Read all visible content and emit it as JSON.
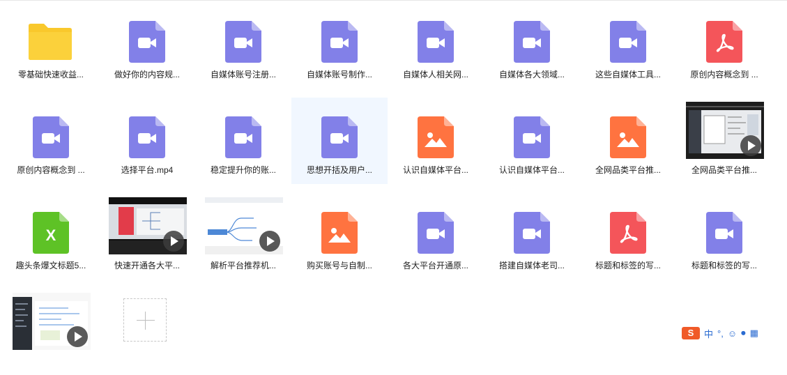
{
  "files": [
    {
      "type": "folder",
      "label": "零基础快速收益..."
    },
    {
      "type": "video",
      "label": "做好你的内容规..."
    },
    {
      "type": "video",
      "label": "自媒体账号注册..."
    },
    {
      "type": "video",
      "label": "自媒体账号制作..."
    },
    {
      "type": "video",
      "label": "自媒体人相关网..."
    },
    {
      "type": "video",
      "label": "自媒体各大领域..."
    },
    {
      "type": "video",
      "label": "这些自媒体工具..."
    },
    {
      "type": "pdf",
      "label": "原创内容概念到 ..."
    },
    {
      "type": "video",
      "label": "原创内容概念到 ..."
    },
    {
      "type": "video",
      "label": "选择平台.mp4"
    },
    {
      "type": "video",
      "label": "稳定提升你的账..."
    },
    {
      "type": "video",
      "label": "思想开括及用户...",
      "selected": true
    },
    {
      "type": "image",
      "label": "认识自媒体平台..."
    },
    {
      "type": "video",
      "label": "认识自媒体平台..."
    },
    {
      "type": "image",
      "label": "全网品类平台推..."
    },
    {
      "type": "thumb",
      "label": "全网品类平台推...",
      "thumb": "desk"
    },
    {
      "type": "excel",
      "label": "趣头条爆文标题5..."
    },
    {
      "type": "thumb",
      "label": "快速开通各大平...",
      "thumb": "mind-dark"
    },
    {
      "type": "thumb",
      "label": "解析平台推荐机...",
      "thumb": "mind-light"
    },
    {
      "type": "image",
      "label": "购买账号与自制..."
    },
    {
      "type": "video",
      "label": "各大平台开通原..."
    },
    {
      "type": "video",
      "label": "搭建自媒体老司..."
    },
    {
      "type": "pdf",
      "label": "标题和标签的写..."
    },
    {
      "type": "video",
      "label": "标题和标签的写..."
    },
    {
      "type": "thumb",
      "label": "",
      "thumb": "editor"
    },
    {
      "type": "add",
      "label": ""
    }
  ],
  "ime": {
    "logo": "S",
    "mode": "中"
  },
  "colors": {
    "folder": "#f9c82c",
    "video": "#8280e8",
    "pdf": "#f4555a",
    "image": "#ff7340",
    "excel": "#5ec226",
    "selected_bg": "#f1f7ff"
  }
}
